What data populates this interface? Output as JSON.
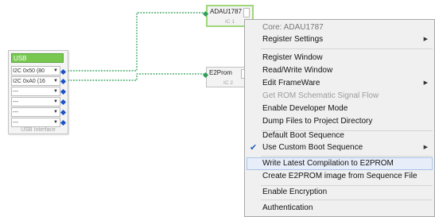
{
  "canvas": {
    "usb_block": {
      "header": "USB",
      "ports": [
        "I2C 0x50 (80",
        "I2C 0xA0 (16",
        "---",
        "---",
        "---",
        "---"
      ],
      "footer": "USB Interface"
    },
    "ic_blocks": [
      {
        "title": "ADAU1787",
        "subtitle": "IC 1"
      },
      {
        "title": "E2Prom",
        "subtitle": "IC 2"
      }
    ]
  },
  "context_menu": {
    "header": "Core: ADAU1787",
    "items": {
      "register_settings": "Register Settings",
      "register_window": "Register Window",
      "read_write_window": "Read/Write Window",
      "edit_frameware": "Edit FrameWare",
      "get_rom_schematic": "Get ROM Schematic Signal Flow",
      "enable_dev_mode": "Enable Developer Mode",
      "dump_files": "Dump Files to Project Directory",
      "default_boot": "Default Boot Sequence",
      "custom_boot": "Use Custom Boot Sequence",
      "write_latest": "Write Latest Compilation to E2PROM",
      "create_e2prom": "Create E2PROM image from Sequence File",
      "enable_encryption": "Enable Encryption",
      "authentication": "Authentication"
    }
  },
  "colors": {
    "wire": "#2e9e58",
    "port": "#1a52c9",
    "usb_header": "#78c850",
    "selected_border": "#9fd77a",
    "menu_hover": "#e8eef9"
  }
}
